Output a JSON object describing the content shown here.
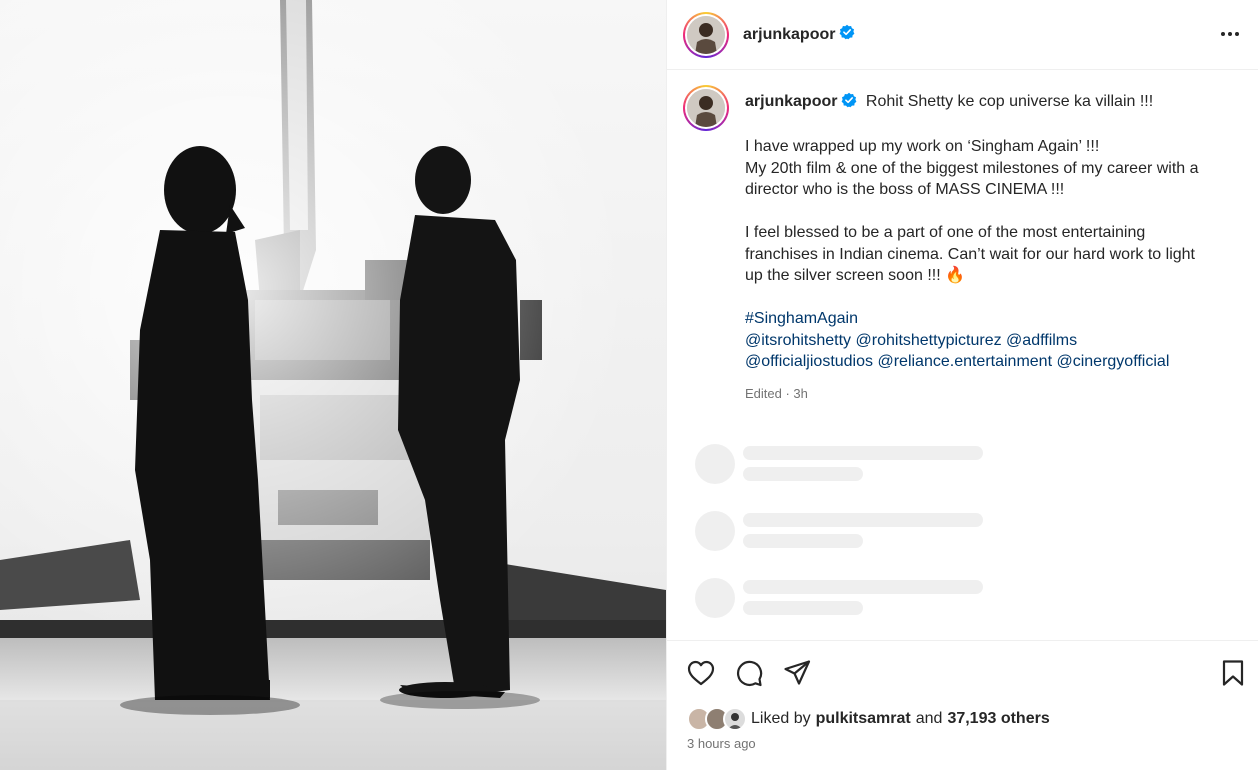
{
  "post": {
    "username": "arjunkapoor",
    "header_icons": {
      "verified": "verified-badge-icon",
      "more": "more-options-icon"
    },
    "image": {
      "description_icon": "post-photo"
    }
  },
  "caption": {
    "username": "arjunkapoor",
    "first_line": "Rohit Shetty ke cop universe ka villain !!!",
    "para2": [
      "I have wrapped up my work on ‘Singham Again’ !!!",
      "My 20th film & one of the biggest milestones of my career with a",
      "director who is the boss of MASS CINEMA !!!"
    ],
    "para3": [
      "I feel blessed to be a part of one of the most entertaining",
      "franchises in Indian cinema. Can’t wait for our hard work to light",
      "up the silver screen soon !!! 🔥"
    ],
    "hashtag": "#SinghamAgain",
    "mentions_line1": [
      "@itsrohitshetty",
      "@rohitshettypicturez",
      "@adffilms"
    ],
    "mentions_line2": [
      "@officialjiostudios",
      "@reliance.entertainment",
      "@cinergyofficial"
    ],
    "meta": "Edited · 3h"
  },
  "actions": {
    "like_icon": "heart-icon",
    "comment_icon": "comment-icon",
    "share_icon": "paper-plane-icon",
    "save_icon": "bookmark-icon"
  },
  "likes": {
    "prefix": "Liked by",
    "liker": "pulkitsamrat",
    "connector": "and",
    "count": "37,193 others"
  },
  "timestamp": "3 hours ago",
  "colors": {
    "link": "#00376b",
    "verified": "#0095f6",
    "muted": "#737373",
    "skeleton": "#efefef"
  }
}
